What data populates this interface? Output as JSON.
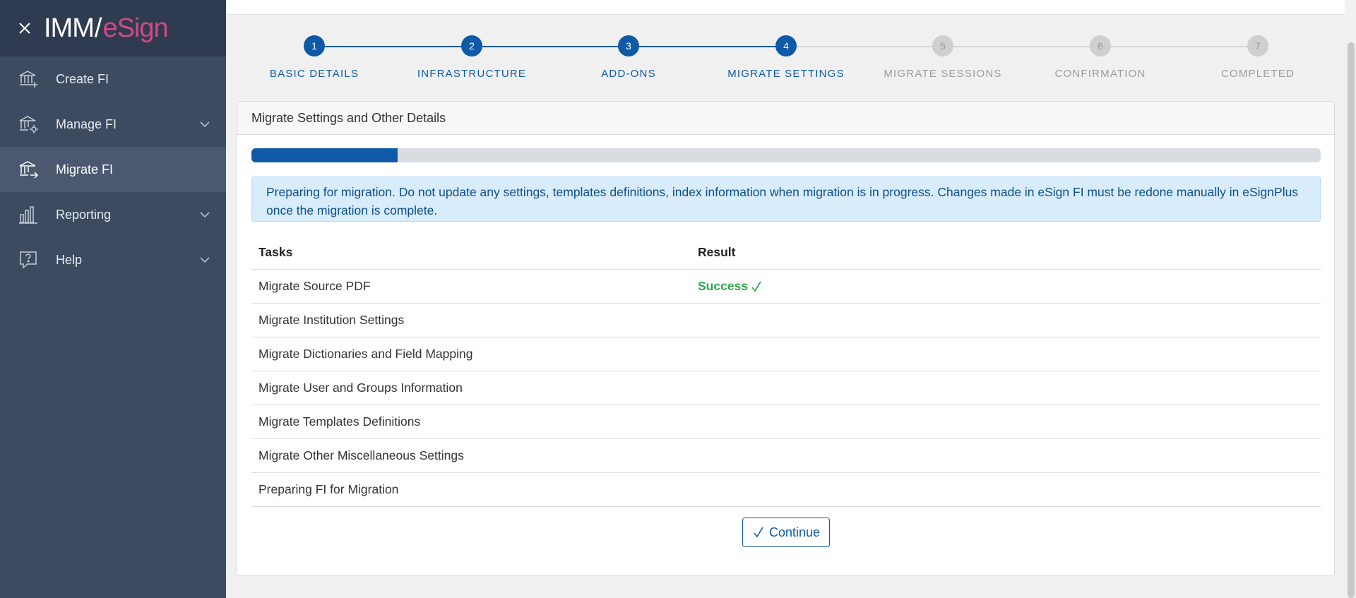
{
  "sidebar": {
    "logo": {
      "imm": "IMM",
      "slash": "/",
      "esign": "eSign"
    },
    "items": [
      {
        "label": "Create FI",
        "icon": "bank-plus-icon"
      },
      {
        "label": "Manage FI",
        "icon": "bank-gear-icon"
      },
      {
        "label": "Migrate FI",
        "icon": "bank-arrow-icon"
      },
      {
        "label": "Reporting",
        "icon": "bar-chart-icon"
      },
      {
        "label": "Help",
        "icon": "help-icon"
      }
    ]
  },
  "stepper": {
    "steps": [
      {
        "num": "1",
        "label": "BASIC DETAILS"
      },
      {
        "num": "2",
        "label": "INFRASTRUCTURE"
      },
      {
        "num": "3",
        "label": "ADD-ONS"
      },
      {
        "num": "4",
        "label": "MIGRATE SETTINGS"
      },
      {
        "num": "5",
        "label": "MIGRATE SESSIONS"
      },
      {
        "num": "6",
        "label": "CONFIRMATION"
      },
      {
        "num": "7",
        "label": "COMPLETED"
      }
    ],
    "current_step": 4
  },
  "card": {
    "title": "Migrate Settings and Other Details",
    "progress_fraction": 0.137,
    "alert": "Preparing for migration. Do not update any settings, templates definitions, index information when migration is in progress. Changes made in eSign FI must be redone manually in eSignPlus once the migration is complete.",
    "table": {
      "headers": [
        "Tasks",
        "Result"
      ],
      "rows": [
        {
          "task": "Migrate Source PDF",
          "result": "Success"
        },
        {
          "task": "Migrate Institution Settings",
          "result": ""
        },
        {
          "task": "Migrate Dictionaries and Field Mapping",
          "result": ""
        },
        {
          "task": "Migrate User and Groups Information",
          "result": ""
        },
        {
          "task": "Migrate Templates Definitions",
          "result": ""
        },
        {
          "task": "Migrate Other Miscellaneous Settings",
          "result": ""
        },
        {
          "task": "Preparing FI for Migration",
          "result": ""
        }
      ]
    },
    "continue_label": "Continue"
  },
  "colors": {
    "primary": "#0e5aa7",
    "success": "#2ea84a",
    "sidebar_bg": "#3d4b61",
    "brand_pink": "#d04a85"
  }
}
